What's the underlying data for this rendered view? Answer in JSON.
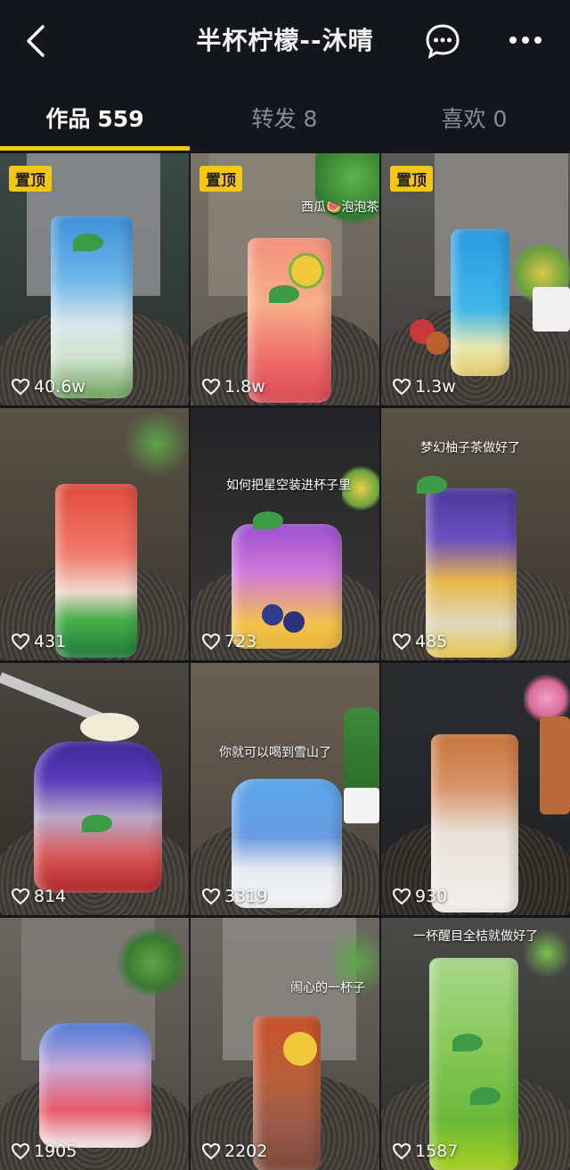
{
  "header": {
    "title": "半杯柠檬--沐晴"
  },
  "tabs": [
    {
      "label": "作品",
      "count": "559",
      "active": true
    },
    {
      "label": "转发",
      "count": "8",
      "active": false
    },
    {
      "label": "喜欢",
      "count": "0",
      "active": false
    }
  ],
  "accent_color": "#f5c518",
  "pin_label": "置顶",
  "videos": [
    {
      "likes": "40.6w",
      "pinned": true,
      "caption": ""
    },
    {
      "likes": "1.8w",
      "pinned": true,
      "caption": "西瓜🍉泡泡茶"
    },
    {
      "likes": "1.3w",
      "pinned": true,
      "caption": ""
    },
    {
      "likes": "431",
      "pinned": false,
      "caption": ""
    },
    {
      "likes": "723",
      "pinned": false,
      "caption": "如何把星空装进杯子里"
    },
    {
      "likes": "485",
      "pinned": false,
      "caption": "梦幻柚子茶做好了"
    },
    {
      "likes": "814",
      "pinned": false,
      "caption": ""
    },
    {
      "likes": "3319",
      "pinned": false,
      "caption": "你就可以喝到雪山了"
    },
    {
      "likes": "930",
      "pinned": false,
      "caption": ""
    },
    {
      "likes": "1905",
      "pinned": false,
      "caption": ""
    },
    {
      "likes": "2202",
      "pinned": false,
      "caption": "闹心的一杯子"
    },
    {
      "likes": "1587",
      "pinned": false,
      "caption": "一杯醒目全桔就做好了"
    }
  ]
}
